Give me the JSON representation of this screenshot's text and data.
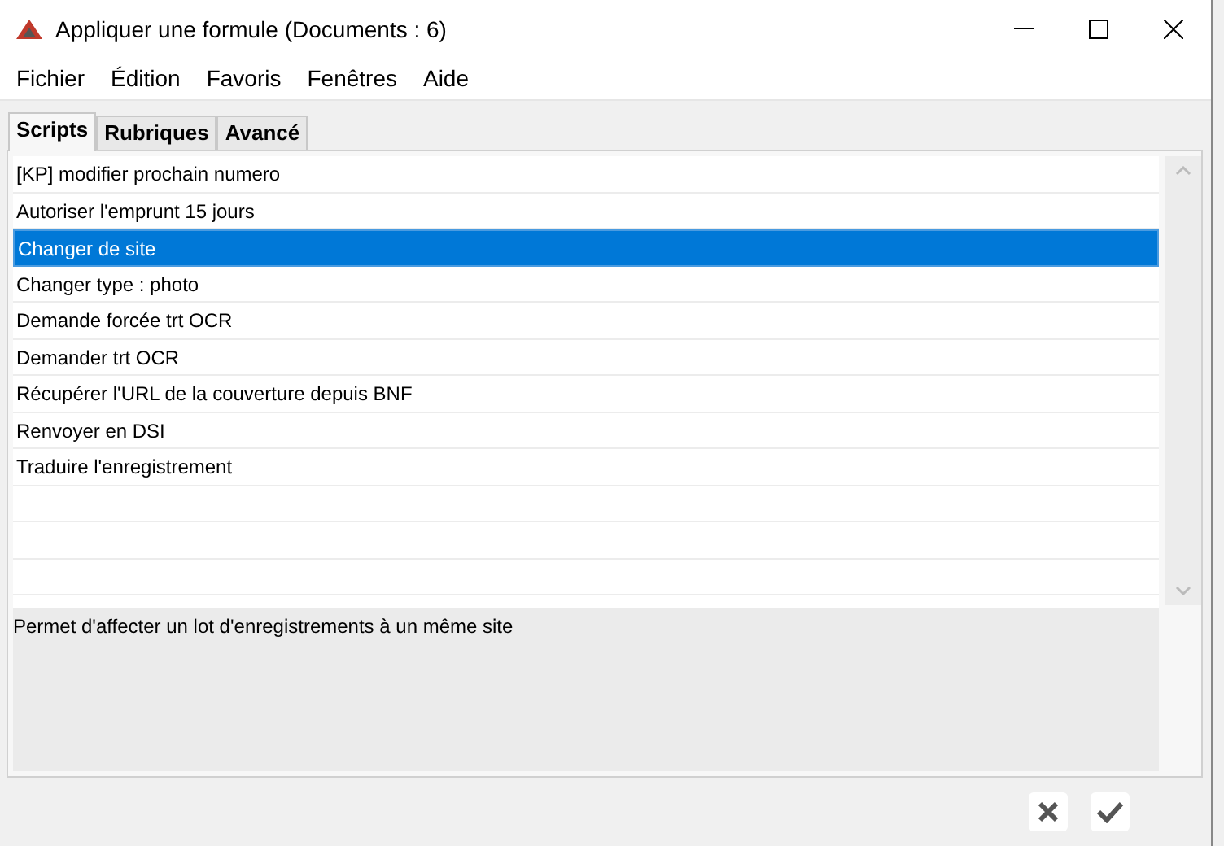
{
  "window": {
    "title": "Appliquer une formule (Documents : 6)"
  },
  "menu": [
    "Fichier",
    "Édition",
    "Favoris",
    "Fenêtres",
    "Aide"
  ],
  "tabs": [
    {
      "label": "Scripts",
      "selected": true
    },
    {
      "label": "Rubriques",
      "selected": false
    },
    {
      "label": "Avancé",
      "selected": false
    }
  ],
  "scripts": [
    {
      "label": "[KP] modifier prochain numero",
      "selected": false
    },
    {
      "label": "Autoriser l'emprunt 15 jours",
      "selected": false
    },
    {
      "label": "Changer de site",
      "selected": true
    },
    {
      "label": "Changer type : photo",
      "selected": false
    },
    {
      "label": "Demande forcée trt OCR",
      "selected": false
    },
    {
      "label": "Demander trt OCR",
      "selected": false
    },
    {
      "label": "Récupérer l'URL de la couverture depuis BNF",
      "selected": false
    },
    {
      "label": "Renvoyer en DSI",
      "selected": false
    },
    {
      "label": "Traduire l'enregistrement",
      "selected": false
    }
  ],
  "description": "Permet d'affecter un lot d'enregistrements à un même site"
}
